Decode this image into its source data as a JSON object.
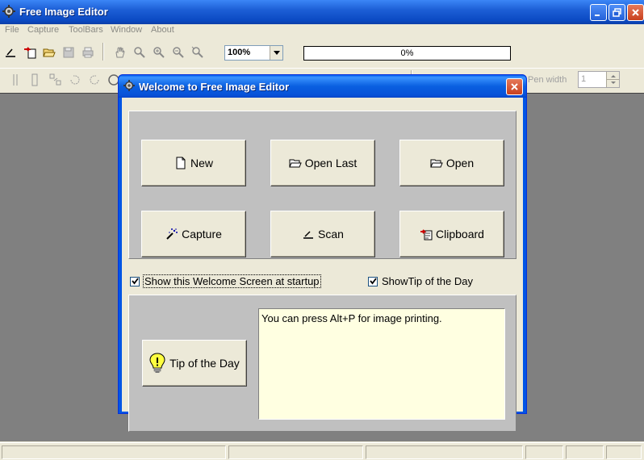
{
  "window": {
    "title": "Free Image Editor"
  },
  "menu": [
    "File",
    "Capture",
    "ToolBars",
    "Window",
    "About"
  ],
  "toolbar": {
    "zoom": "100%",
    "progress": "0%",
    "pen_width_label": "Pen width",
    "pen_width": "1"
  },
  "dialog": {
    "title": "Welcome to Free Image Editor",
    "buttons": {
      "new": "New",
      "open_last": "Open Last",
      "open": "Open",
      "capture": "Capture",
      "scan": "Scan",
      "clipboard": "Clipboard"
    },
    "show_welcome_label": "Show this Welcome Screen at startup",
    "show_tip_label": "ShowTip of the Day",
    "tip_button": "Tip of the Day",
    "tip_text": "You can press Alt+P for image printing."
  },
  "colors": {
    "xp_blue": "#0055e5",
    "tip_bg": "#ffffe1",
    "workspace": "#808080"
  }
}
